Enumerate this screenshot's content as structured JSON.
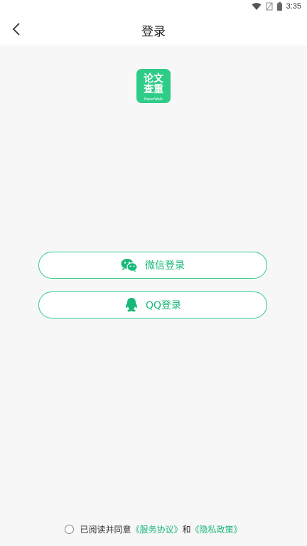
{
  "status_bar": {
    "time": "3:35"
  },
  "header": {
    "title": "登录"
  },
  "logo": {
    "line1": "论文",
    "line2": "查重",
    "brand": "PaperWalk"
  },
  "buttons": {
    "wechat_label": "微信登录",
    "qq_label": "QQ登录"
  },
  "footer": {
    "agree_text": "已阅读并同意",
    "service_link": "《服务协议》",
    "and_text": "和",
    "privacy_link": "《隐私政策》"
  },
  "colors": {
    "accent": "#18b878",
    "border": "#2ecc87",
    "background": "#f8f7f8"
  }
}
